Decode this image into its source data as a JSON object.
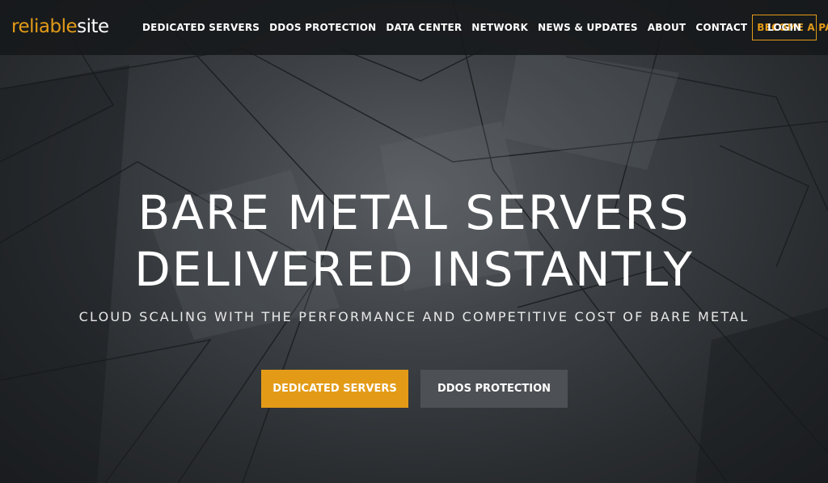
{
  "logo": {
    "part1": "reliable",
    "part2": "site"
  },
  "nav": {
    "items": [
      "DEDICATED SERVERS",
      "DDOS PROTECTION",
      "DATA CENTER",
      "NETWORK",
      "NEWS & UPDATES",
      "ABOUT",
      "CONTACT",
      "BECOME A PARTNER"
    ],
    "login": "LOGIN"
  },
  "hero": {
    "headline_line1": "BARE METAL SERVERS",
    "headline_line2": "DELIVERED INSTANTLY",
    "subheadline": "CLOUD SCALING WITH THE PERFORMANCE AND COMPETITIVE COST OF BARE METAL",
    "primary_cta": "DEDICATED SERVERS",
    "secondary_cta": "DDOS PROTECTION"
  },
  "colors": {
    "accent": "#e39b17",
    "secondary_button": "#4d5155",
    "topbar": "#16181a"
  }
}
